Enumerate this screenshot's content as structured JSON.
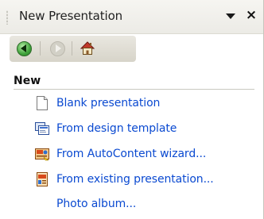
{
  "titlebar": {
    "title": "New Presentation",
    "dropdown_icon": "dropdown-triangle-icon",
    "close_glyph": "×"
  },
  "navbar": {
    "back_icon": "back-arrow-icon",
    "forward_icon": "forward-arrow-icon",
    "home_icon": "home-icon"
  },
  "section": {
    "heading": "New",
    "items": [
      {
        "label": "Blank presentation",
        "icon": "blank-document-icon"
      },
      {
        "label": "From design template",
        "icon": "design-template-icon"
      },
      {
        "label": "From AutoContent wizard...",
        "icon": "autocontent-wizard-icon"
      },
      {
        "label": "From existing presentation...",
        "icon": "existing-presentation-icon"
      },
      {
        "label": "Photo album...",
        "icon": ""
      }
    ]
  },
  "colors": {
    "link": "#0b4ad1",
    "titlebar_bg": "#f0efea",
    "navbar_bg": "#e0ddd4",
    "back_button": "#3fa23a"
  }
}
